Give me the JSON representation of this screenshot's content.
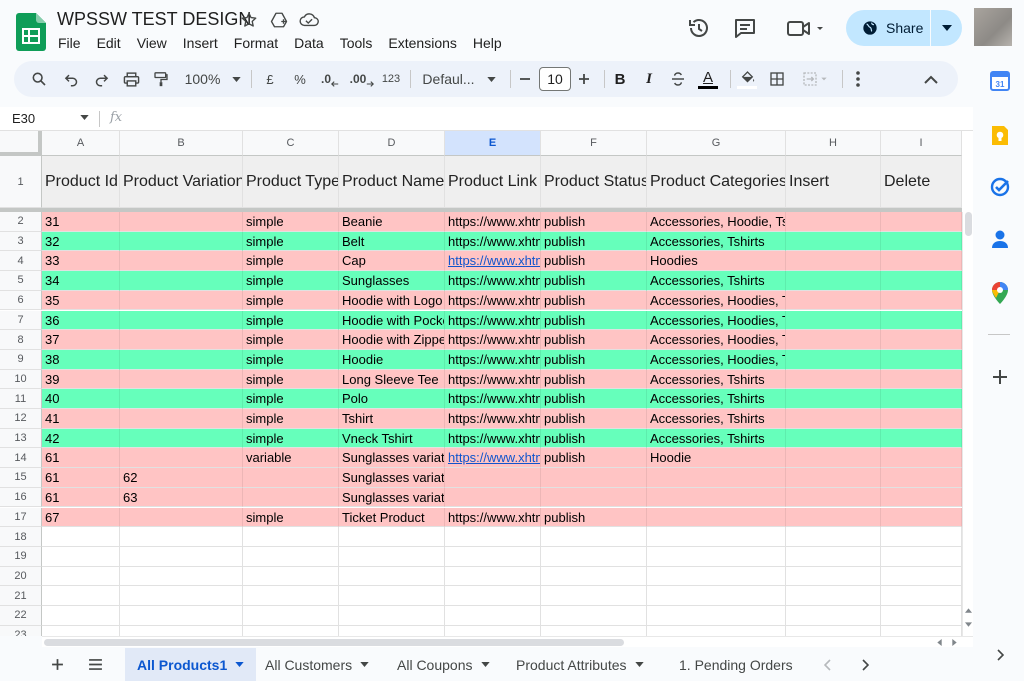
{
  "app": {
    "title": "WPSSW TEST DESIGN",
    "menu": [
      "File",
      "Edit",
      "View",
      "Insert",
      "Format",
      "Data",
      "Tools",
      "Extensions",
      "Help"
    ],
    "share_label": "Share",
    "colors": {
      "accent": "#0b57d0",
      "share_bg": "#c2e7ff",
      "pink_row": "#ffc4c4",
      "green_row": "#66ffbb",
      "logo": "#0f9d58"
    }
  },
  "toolbar": {
    "zoom": "100%",
    "currency": "£",
    "percent": "%",
    "dec_decrease": ".0",
    "dec_increase": ".00",
    "number_format": "123",
    "font": "Defaul...",
    "font_size": "10",
    "bold": "B",
    "italic": "I",
    "text_color": "A"
  },
  "formula": {
    "cell_ref": "E30",
    "fx": "fx",
    "value": ""
  },
  "columns": [
    "A",
    "B",
    "C",
    "D",
    "E",
    "F",
    "G",
    "H",
    "I"
  ],
  "selected_column": "E",
  "header_row": [
    "Product Id",
    "Product Variation",
    "Product Type",
    "Product Name",
    "Product Link",
    "Product Status",
    "Product Categories",
    "Insert",
    "Delete"
  ],
  "row_numbers": [
    "1",
    "2",
    "3",
    "4",
    "5",
    "6",
    "7",
    "8",
    "9",
    "10",
    "11",
    "12",
    "13",
    "14",
    "15",
    "16",
    "17",
    "18",
    "19",
    "20",
    "21",
    "22",
    "23"
  ],
  "rows": [
    {
      "color": "pink",
      "cells": [
        "31",
        "",
        "simple",
        "Beanie",
        "https://www.xhtm",
        "publish",
        "Accessories, Hoodie, Tshirts",
        "",
        ""
      ]
    },
    {
      "color": "green",
      "cells": [
        "32",
        "",
        "simple",
        "Belt",
        "https://www.xhtm",
        "publish",
        "Accessories, Tshirts",
        "",
        ""
      ]
    },
    {
      "color": "pink",
      "link": true,
      "cells": [
        "33",
        "",
        "simple",
        "Cap",
        "https://www.xhtm",
        "publish",
        "Hoodies",
        "",
        ""
      ]
    },
    {
      "color": "green",
      "cells": [
        "34",
        "",
        "simple",
        "Sunglasses",
        "https://www.xhtm",
        "publish",
        "Accessories, Tshirts",
        "",
        ""
      ]
    },
    {
      "color": "pink",
      "cells": [
        "35",
        "",
        "simple",
        "Hoodie with Logo",
        "https://www.xhtm",
        "publish",
        "Accessories, Hoodies, Tshirts",
        "",
        ""
      ]
    },
    {
      "color": "green",
      "cells": [
        "36",
        "",
        "simple",
        "Hoodie with Pocke",
        "https://www.xhtm",
        "publish",
        "Accessories, Hoodies, Tshirts",
        "",
        ""
      ]
    },
    {
      "color": "pink",
      "cells": [
        "37",
        "",
        "simple",
        "Hoodie with Zipper",
        "https://www.xhtm",
        "publish",
        "Accessories, Hoodies, Tshirts",
        "",
        ""
      ]
    },
    {
      "color": "green",
      "cells": [
        "38",
        "",
        "simple",
        "Hoodie",
        "https://www.xhtm",
        "publish",
        "Accessories, Hoodies, Tshirts",
        "",
        ""
      ]
    },
    {
      "color": "pink",
      "cells": [
        "39",
        "",
        "simple",
        "Long Sleeve Tee",
        "https://www.xhtm",
        "publish",
        "Accessories, Tshirts",
        "",
        ""
      ]
    },
    {
      "color": "green",
      "cells": [
        "40",
        "",
        "simple",
        "Polo",
        "https://www.xhtm",
        "publish",
        "Accessories, Tshirts",
        "",
        ""
      ]
    },
    {
      "color": "pink",
      "cells": [
        "41",
        "",
        "simple",
        "Tshirt",
        "https://www.xhtm",
        "publish",
        "Accessories, Tshirts",
        "",
        ""
      ]
    },
    {
      "color": "green",
      "cells": [
        "42",
        "",
        "simple",
        "Vneck Tshirt",
        "https://www.xhtm",
        "publish",
        "Accessories, Tshirts",
        "",
        ""
      ]
    },
    {
      "color": "pink",
      "link": true,
      "cells": [
        "61",
        "",
        "variable",
        "Sunglasses variati",
        "https://www.xhtm",
        "publish",
        "Hoodie",
        "",
        ""
      ]
    },
    {
      "color": "pink",
      "cells": [
        "61",
        "62",
        "",
        "Sunglasses variation",
        "",
        "",
        "",
        "",
        ""
      ]
    },
    {
      "color": "pink",
      "cells": [
        "61",
        "63",
        "",
        "Sunglasses variation",
        "",
        "",
        "",
        "",
        ""
      ]
    },
    {
      "color": "pink",
      "cells": [
        "67",
        "",
        "simple",
        "Ticket Product",
        "https://www.xhtm",
        "publish",
        "",
        "",
        ""
      ]
    },
    {
      "color": "white",
      "cells": [
        "",
        "",
        "",
        "",
        "",
        "",
        "",
        "",
        ""
      ]
    },
    {
      "color": "white",
      "cells": [
        "",
        "",
        "",
        "",
        "",
        "",
        "",
        "",
        ""
      ]
    },
    {
      "color": "white",
      "cells": [
        "",
        "",
        "",
        "",
        "",
        "",
        "",
        "",
        ""
      ]
    },
    {
      "color": "white",
      "cells": [
        "",
        "",
        "",
        "",
        "",
        "",
        "",
        "",
        ""
      ]
    },
    {
      "color": "white",
      "cells": [
        "",
        "",
        "",
        "",
        "",
        "",
        "",
        "",
        ""
      ]
    },
    {
      "color": "white",
      "cells": [
        "",
        "",
        "",
        "",
        "",
        "",
        "",
        "",
        ""
      ]
    }
  ],
  "sheets": [
    {
      "label": "All Products1",
      "active": true
    },
    {
      "label": "All Customers",
      "active": false
    },
    {
      "label": "All Coupons",
      "active": false
    },
    {
      "label": "Product Attributes",
      "active": false
    },
    {
      "label": "1. Pending Orders",
      "active": false
    }
  ],
  "side_panel": [
    "calendar-icon",
    "keep-icon",
    "tasks-icon",
    "contacts-icon",
    "maps-icon",
    "add-icon"
  ]
}
